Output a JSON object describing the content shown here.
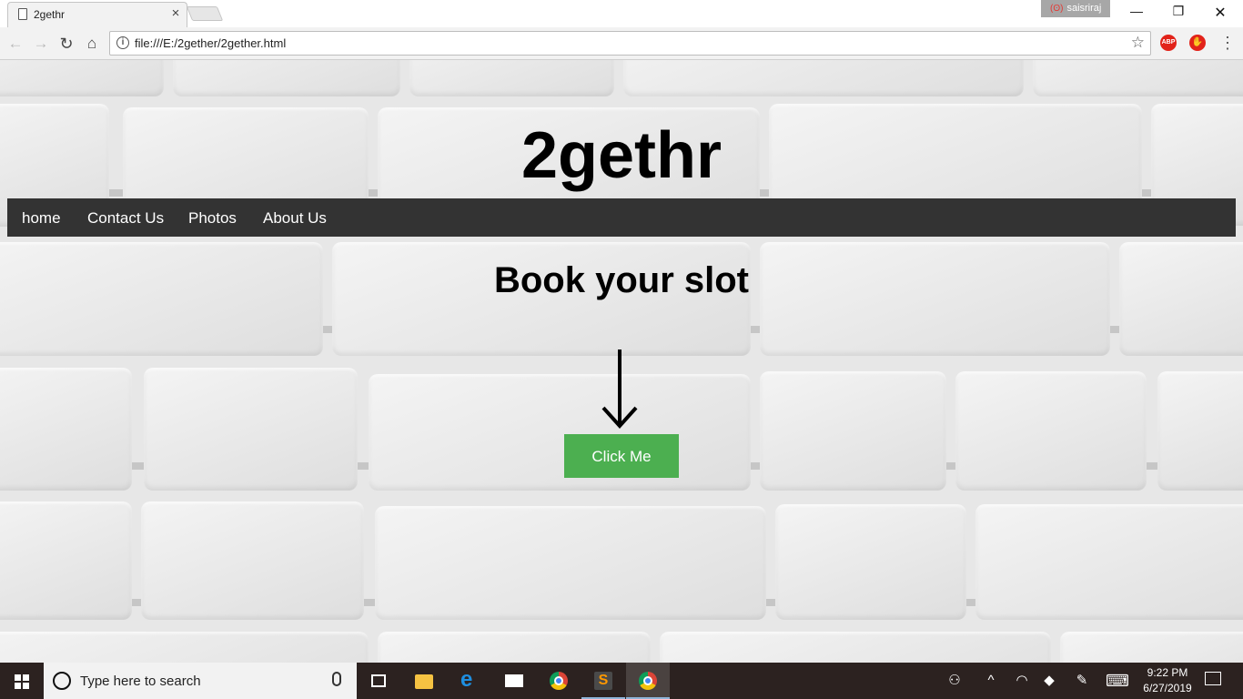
{
  "browser": {
    "tab_title": "2gethr",
    "tab_close": "×",
    "user_name": "saisriraj",
    "minimize": "—",
    "maximize": "❐",
    "close": "✕",
    "back": "←",
    "forward": "→",
    "reload": "↻",
    "home": "⌂",
    "url": "file:///E:/2gether/2gether.html",
    "star": "☆",
    "ext_abp": "ABP",
    "ext_stop": "✋",
    "menu": "⋮"
  },
  "page": {
    "title": "2gethr",
    "nav": [
      "home",
      "Contact Us",
      "Photos",
      "About Us"
    ],
    "headline": "Book your slot",
    "button_label": "Click Me",
    "colors": {
      "nav_bg": "#333333",
      "button_bg": "#4caf50",
      "button_text": "#ffffff"
    }
  },
  "taskbar": {
    "search_placeholder": "Type here to search",
    "apps": [
      "task-view",
      "file-explorer",
      "edge",
      "mail",
      "chrome",
      "sublime-text",
      "chrome-active"
    ],
    "tray": {
      "people": "⚇",
      "chevron": "^",
      "network": "◠",
      "dropbox": "◆",
      "pen": "✎",
      "keyboard": "⌨"
    },
    "time": "9:22 PM",
    "date": "6/27/2019"
  }
}
